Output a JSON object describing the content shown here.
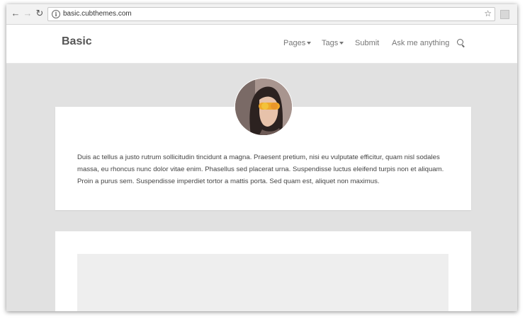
{
  "browser": {
    "url": "basic.cubthemes.com",
    "back_icon": "arrow-left-icon",
    "forward_icon": "arrow-right-icon",
    "reload_icon": "reload-icon",
    "bookmark_icon": "star-icon"
  },
  "header": {
    "brand": "Basic",
    "nav": [
      {
        "label": "Pages"
      },
      {
        "label": "Tags"
      },
      {
        "label": "Submit"
      },
      {
        "label": "Ask me anything"
      }
    ]
  },
  "post": {
    "excerpt": "Duis ac tellus a justo rutrum sollicitudin tincidunt a magna. Praesent pretium, nisi eu vulputate efficitur, quam nisl sodales massa, eu rhoncus nunc dolor vitae enim. Phasellus sed placerat urna. Suspendisse luctus eleifend turpis non et aliquam. Proin a purus sem. Suspendisse imperdiet tortor a mattis porta. Sed quam est, aliquet non maximus."
  },
  "colors": {
    "page_bg": "#e1e1e1",
    "card_bg": "#ffffff",
    "text": "#444444",
    "nav_text": "#777777"
  }
}
